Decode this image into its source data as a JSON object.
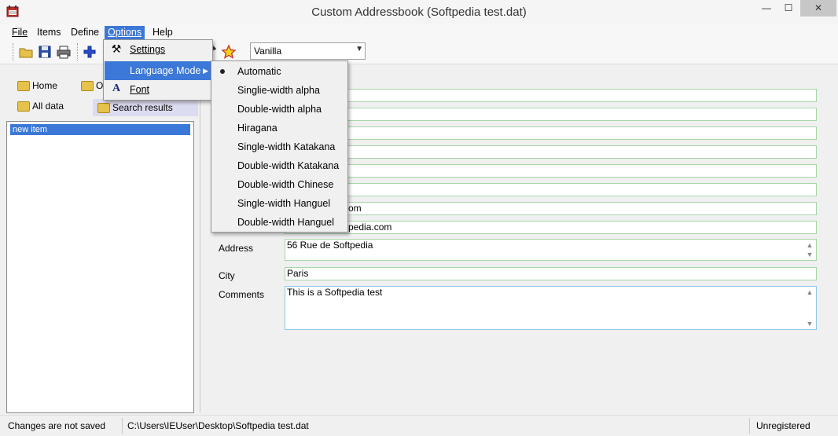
{
  "window": {
    "title": "Custom Addressbook (Softpedia test.dat)",
    "min": "—",
    "max": "☐",
    "close": "✕"
  },
  "menubar": {
    "items": [
      {
        "label": "File"
      },
      {
        "label": "Items"
      },
      {
        "label": "Define"
      },
      {
        "label": "Options"
      },
      {
        "label": "Help"
      }
    ]
  },
  "toolbar": {
    "combo_value": "Vanilla"
  },
  "tabs": [
    {
      "label": "Home"
    },
    {
      "label": "Of"
    },
    {
      "label": "All data"
    },
    {
      "label": "Search results"
    }
  ],
  "list": {
    "items": [
      "new item"
    ]
  },
  "form": {
    "visible_values": [
      {
        "value": "om"
      },
      {
        "value": "pedia.com"
      }
    ],
    "address_label": "Address",
    "address_value": "56 Rue de Softpedia",
    "city_label": "City",
    "city_value": "Paris",
    "comments_label": "Comments",
    "comments_value": "This is a Softpedia test"
  },
  "options_menu": {
    "items": [
      {
        "label": "Settings"
      },
      {
        "label": "Language Mode"
      },
      {
        "label": "Font"
      }
    ]
  },
  "language_submenu": {
    "items": [
      {
        "label": "Automatic",
        "checked": true
      },
      {
        "label": "Singlie-width alpha"
      },
      {
        "label": "Double-width alpha"
      },
      {
        "label": "Hiragana"
      },
      {
        "label": "Single-width Katakana"
      },
      {
        "label": "Double-width Katakana"
      },
      {
        "label": "Double-width Chinese"
      },
      {
        "label": "Single-width Hanguel"
      },
      {
        "label": "Double-width Hanguel"
      }
    ]
  },
  "status": {
    "saved": "Changes are not saved",
    "path": "C:\\Users\\IEUser\\Desktop\\Softpedia test.dat",
    "registration": "Unregistered"
  },
  "colors": {
    "highlight": "#3c78d8",
    "field_border": "#a8d5a8",
    "comments_border": "#8cc7e6"
  }
}
